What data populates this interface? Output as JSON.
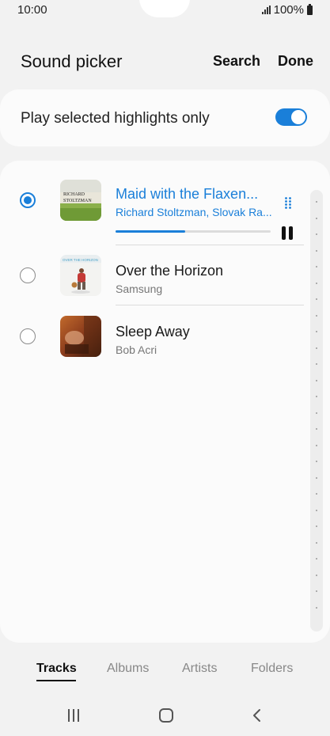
{
  "status_bar": {
    "time": "10:00",
    "battery": "100%"
  },
  "header": {
    "title": "Sound picker",
    "search_label": "Search",
    "done_label": "Done"
  },
  "toggle": {
    "label": "Play selected highlights only",
    "enabled": true
  },
  "tracks": [
    {
      "title": "Maid with the Flaxen...",
      "artist": "Richard Stoltzman, Slovak Ra...",
      "selected": true,
      "playing": true,
      "progress": 0.45,
      "art_text": [
        "RICHARD",
        "STOLTZMAN"
      ]
    },
    {
      "title": "Over the Horizon",
      "artist": "Samsung",
      "selected": false,
      "playing": false,
      "art_text": [
        "OVER THE HORIZON"
      ]
    },
    {
      "title": "Sleep Away",
      "artist": "Bob Acri",
      "selected": false,
      "playing": false
    }
  ],
  "tabs": [
    {
      "label": "Tracks",
      "active": true
    },
    {
      "label": "Albums",
      "active": false
    },
    {
      "label": "Artists",
      "active": false
    },
    {
      "label": "Folders",
      "active": false
    }
  ],
  "colors": {
    "accent": "#1a7fd9",
    "background": "#f2f2f2",
    "card": "#fbfbfb"
  },
  "icons": {
    "signal": "signal-icon",
    "battery": "battery-icon",
    "drag_handle": "drag-handle-icon",
    "pause": "pause-icon",
    "recents": "recents-icon",
    "home": "home-icon",
    "back": "back-icon"
  }
}
